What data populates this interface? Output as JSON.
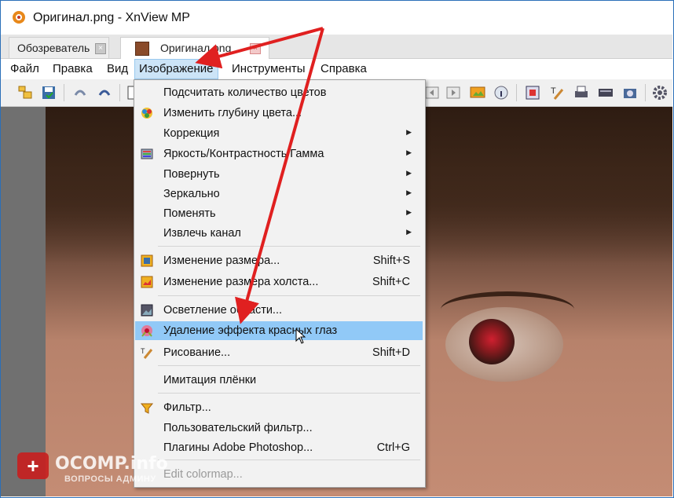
{
  "window": {
    "title": "Оригинал.png - XnView MP"
  },
  "tabs": [
    {
      "label": "Обозреватель",
      "close": "×"
    },
    {
      "label": "Оригинал.png",
      "close": "×"
    }
  ],
  "menubar": [
    "Файл",
    "Правка",
    "Вид",
    "Изображение",
    "Инструменты",
    "Справка"
  ],
  "image_menu": {
    "items": [
      {
        "label": "Подсчитать количество цветов",
        "shortcut": "",
        "icon": "none"
      },
      {
        "label": "Изменить глубину цвета...",
        "shortcut": "",
        "icon": "color-depth-icon"
      },
      {
        "label": "Коррекция",
        "shortcut": "",
        "icon": "none",
        "submenu": "▶"
      },
      {
        "label": "Яркость/Контрастность/Гамма",
        "shortcut": "",
        "icon": "brightness-icon",
        "submenu": "▶"
      },
      {
        "label": "Повернуть",
        "shortcut": "",
        "icon": "none",
        "submenu": "▶"
      },
      {
        "label": "Зеркально",
        "shortcut": "",
        "icon": "none",
        "submenu": "▶"
      },
      {
        "label": "Поменять",
        "shortcut": "",
        "icon": "none",
        "submenu": "▶"
      },
      {
        "label": "Извлечь канал",
        "shortcut": "",
        "icon": "none",
        "submenu": "▶"
      },
      {
        "label": "Изменение размера...",
        "shortcut": "Shift+S",
        "icon": "resize-icon"
      },
      {
        "label": "Изменение размера холста...",
        "shortcut": "Shift+C",
        "icon": "canvas-icon"
      },
      {
        "label": "Осветление области...",
        "shortcut": "",
        "icon": "lighten-icon"
      },
      {
        "label": "Удаление эффекта красных глаз",
        "shortcut": "",
        "icon": "redeye-icon"
      },
      {
        "label": "Рисование...",
        "shortcut": "Shift+D",
        "icon": "draw-icon"
      },
      {
        "label": "Имитация плёнки",
        "shortcut": "",
        "icon": "none"
      },
      {
        "label": "Фильтр...",
        "shortcut": "",
        "icon": "filter-icon"
      },
      {
        "label": "Пользовательский фильтр...",
        "shortcut": "",
        "icon": "none"
      },
      {
        "label": "Плагины Adobe Photoshop...",
        "shortcut": "Ctrl+G",
        "icon": "none"
      },
      {
        "label": "Edit colormap...",
        "shortcut": "",
        "icon": "none"
      }
    ]
  },
  "watermark": {
    "main": "OCOMP.info",
    "sub": "ВОПРОСЫ АДМИНУ",
    "badge": "+"
  },
  "colors": {
    "accent": "#2b6fb8",
    "highlight": "#91c9f7",
    "arrow": "#e02020"
  }
}
